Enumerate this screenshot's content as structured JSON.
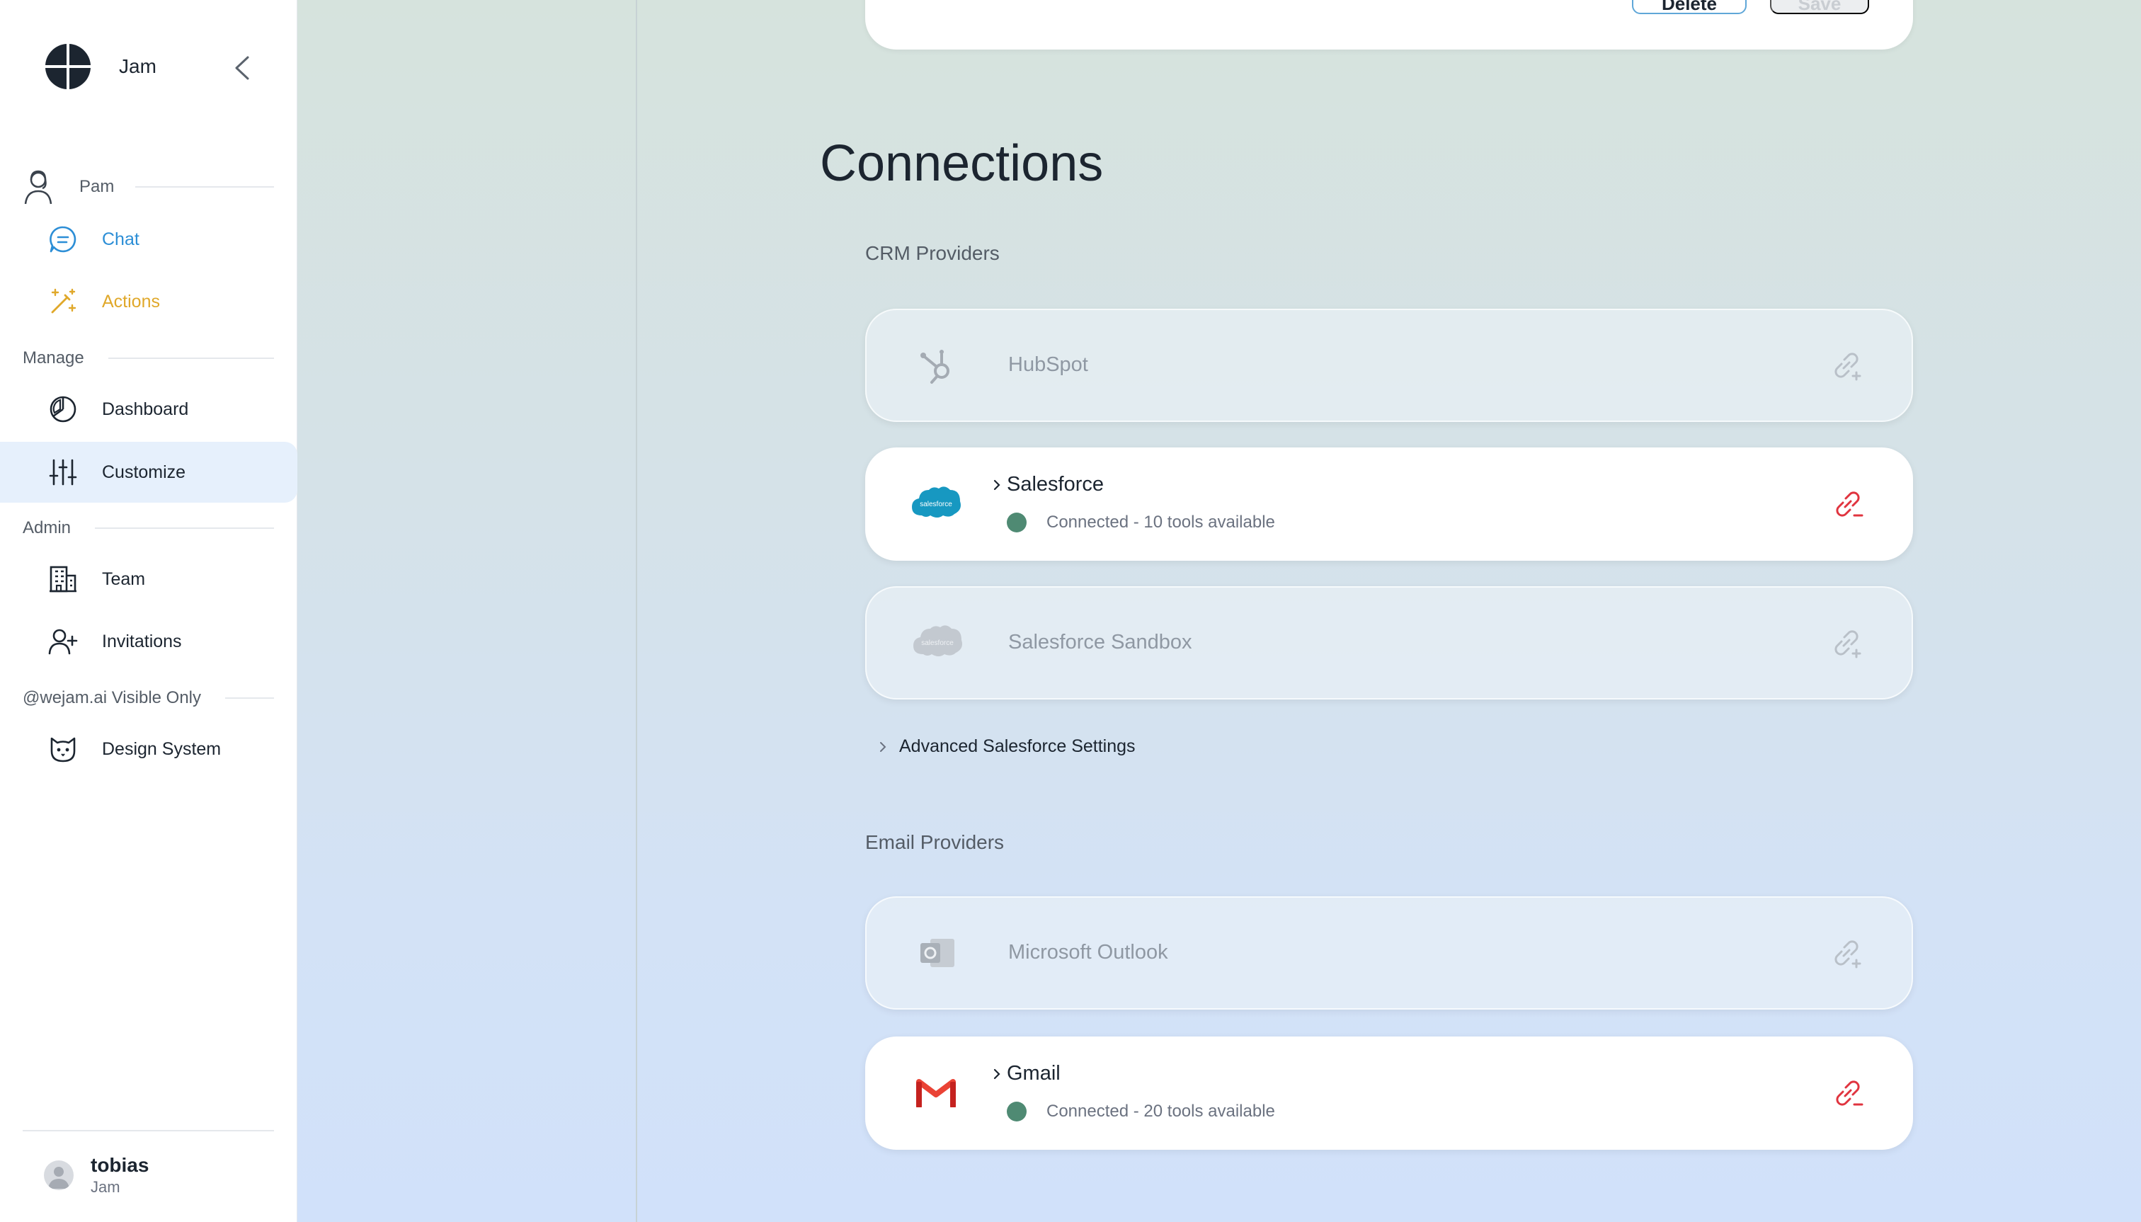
{
  "app": {
    "name": "Jam"
  },
  "sidebar": {
    "user_section": {
      "label": "Pam"
    },
    "user_items": [
      {
        "label": "Chat",
        "icon": "chat-bubble-icon",
        "color": "#2c8ed6"
      },
      {
        "label": "Actions",
        "icon": "magic-wand-icon",
        "color": "#e0a82a"
      }
    ],
    "manage": {
      "label": "Manage",
      "items": [
        {
          "label": "Dashboard",
          "icon": "pie-chart-icon"
        },
        {
          "label": "Customize",
          "icon": "sliders-icon",
          "active": true
        }
      ]
    },
    "admin": {
      "label": "Admin",
      "items": [
        {
          "label": "Team",
          "icon": "building-icon"
        },
        {
          "label": "Invitations",
          "icon": "add-user-icon"
        }
      ]
    },
    "internal": {
      "label": "@wejam.ai Visible Only",
      "items": [
        {
          "label": "Design System",
          "icon": "cat-face-icon"
        }
      ]
    },
    "profile": {
      "name": "tobias",
      "org": "Jam"
    }
  },
  "toolbar": {
    "delete_label": "Delete",
    "save_label": "Save"
  },
  "main": {
    "title": "Connections",
    "crm": {
      "label": "CRM Providers",
      "providers": [
        {
          "name": "HubSpot",
          "connected": false
        },
        {
          "name": "Salesforce",
          "connected": true,
          "status": "Connected - 10 tools available"
        },
        {
          "name": "Salesforce Sandbox",
          "connected": false
        }
      ],
      "advanced_label": "Advanced Salesforce Settings"
    },
    "email": {
      "label": "Email Providers",
      "providers": [
        {
          "name": "Microsoft Outlook",
          "connected": false
        },
        {
          "name": "Gmail",
          "connected": true,
          "status": "Connected - 20 tools available"
        }
      ]
    }
  },
  "colors": {
    "accent_blue": "#2c8ed6",
    "actions_yellow": "#e0a82a",
    "connected_green": "#4f8a73",
    "disconnect_red": "#e0343f",
    "salesforce_blue": "#1798c1",
    "gmail_red": "#ea4335"
  }
}
